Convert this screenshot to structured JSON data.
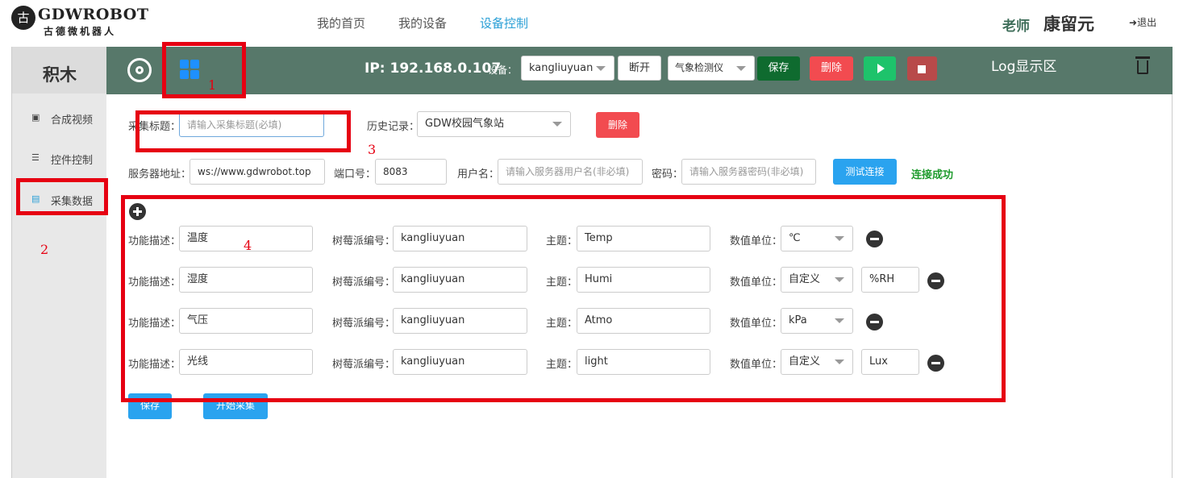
{
  "header": {
    "logo_glyph": "古",
    "logo_text": "GDWROBOT",
    "logo_sub": "古德微机器人",
    "nav": [
      "我的首页",
      "我的设备",
      "设备控制"
    ],
    "active_nav": "设备控制",
    "user_role": "老师",
    "user_name": "康留元",
    "logout_icon": "➜",
    "logout_label": "退出"
  },
  "sidebar": {
    "title": "积木",
    "items": [
      {
        "icon": "image-icon",
        "glyph": "▣",
        "label": "合成视频"
      },
      {
        "icon": "sliders-icon",
        "glyph": "☰",
        "label": "控件控制"
      },
      {
        "icon": "chart-icon",
        "glyph": "▤",
        "label": "采集数据",
        "active": true
      }
    ]
  },
  "toolbar": {
    "ip_text": "IP: 192.168.0.107",
    "device_label": "设备：",
    "device_value": "kangliuyuan",
    "disconnect_label": "断开",
    "program_value": "气象检测仪",
    "save_label": "保存",
    "delete_label": "删除",
    "log_title": "Log显示区"
  },
  "form": {
    "title_label": "采集标题：",
    "title_placeholder": "请输入采集标题(必填)",
    "history_label": "历史记录：",
    "history_value": "GDW校园气象站",
    "delete_label": "删除",
    "server_label": "服务器地址：",
    "server_value": "ws://www.gdwrobot.top",
    "port_label": "端口号：",
    "port_value": "8083",
    "user_label": "用户名：",
    "user_placeholder": "请输入服务器用户名(非必填)",
    "pass_label": "密码：",
    "pass_placeholder": "请输入服务器密码(非必填)",
    "test_label": "测试连接",
    "status_text": "连接成功",
    "desc_label": "功能描述：",
    "pi_label": "树莓派编号：",
    "topic_label": "主题：",
    "unit_label": "数值单位：",
    "rows": [
      {
        "desc": "温度",
        "pi": "kangliuyuan",
        "topic": "Temp",
        "unit": "℃",
        "custom": ""
      },
      {
        "desc": "湿度",
        "pi": "kangliuyuan",
        "topic": "Humi",
        "unit": "自定义",
        "custom": "%RH"
      },
      {
        "desc": "气压",
        "pi": "kangliuyuan",
        "topic": "Atmo",
        "unit": "kPa",
        "custom": ""
      },
      {
        "desc": "光线",
        "pi": "kangliuyuan",
        "topic": "light",
        "unit": "自定义",
        "custom": "Lux"
      }
    ],
    "save_label": "保存",
    "start_label": "开始采集"
  },
  "annotations": [
    "1",
    "2",
    "3",
    "4"
  ],
  "colors": {
    "header_bar": "#57786a",
    "accent_blue": "#2aa3ef",
    "danger": "#f24b50",
    "success_text": "#1e9b2d",
    "annotation_red": "#e60012"
  }
}
